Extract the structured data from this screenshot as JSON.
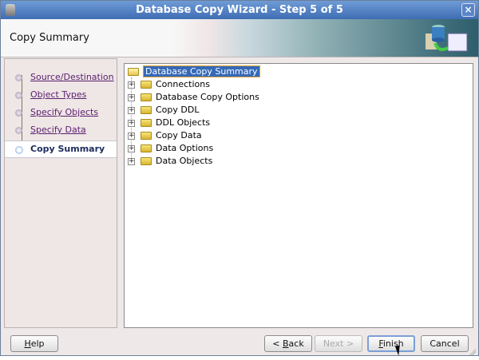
{
  "window": {
    "title": "Database Copy Wizard - Step 5 of 5",
    "close": "×"
  },
  "header": {
    "title": "Copy Summary"
  },
  "steps": [
    {
      "label": "Source/Destination"
    },
    {
      "label": "Object Types"
    },
    {
      "label": "Specify Objects"
    },
    {
      "label": "Specify Data"
    },
    {
      "label": "Copy Summary",
      "current": true
    }
  ],
  "tree": {
    "root": "Database Copy Summary",
    "children": [
      "Connections",
      "Database Copy Options",
      "Copy DDL",
      "DDL Objects",
      "Copy Data",
      "Data Options",
      "Data Objects"
    ],
    "expand": "+"
  },
  "buttons": {
    "help_h": "H",
    "help": "elp",
    "back_pre": "< ",
    "back_b": "B",
    "back": "ack",
    "next": "Next >",
    "finish_f": "F",
    "finish": "inish",
    "cancel": "Cancel"
  }
}
